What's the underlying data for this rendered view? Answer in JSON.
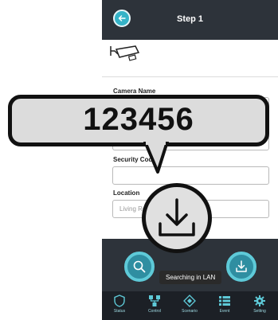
{
  "header": {
    "title": "Step 1"
  },
  "form": {
    "camera_name_label": "Camera Name",
    "security_code_label": "Security Code",
    "location_label": "Location",
    "location_placeholder": "Living Room"
  },
  "overlay": {
    "code_text": "123456"
  },
  "tooltip": {
    "text": "Searching in LAN"
  },
  "tabs": [
    {
      "label": "Status",
      "icon": "shield-icon"
    },
    {
      "label": "Control",
      "icon": "network-icon"
    },
    {
      "label": "Scenario",
      "icon": "diamond-icon"
    },
    {
      "label": "Event",
      "icon": "list-icon"
    },
    {
      "label": "Setting",
      "icon": "gear-icon"
    }
  ],
  "colors": {
    "header_bg": "#2d333a",
    "accent": "#35b3c7",
    "tab_icon": "#5ecad8",
    "tabbar_bg": "#1c2026"
  }
}
